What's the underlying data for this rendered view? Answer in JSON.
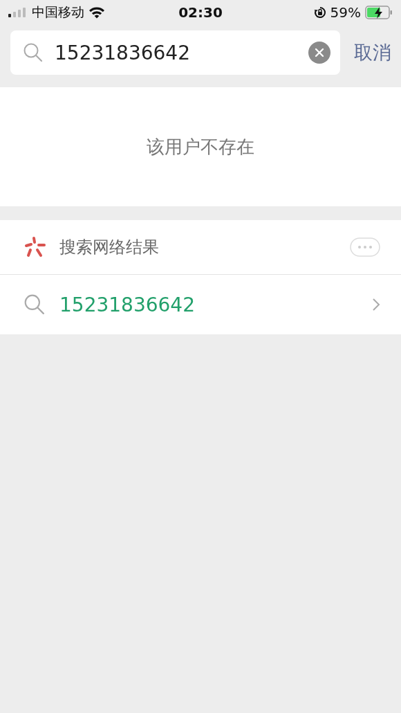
{
  "status_bar": {
    "carrier": "中国移动",
    "time": "02:30",
    "battery_percent": "59%"
  },
  "search": {
    "value": "15231836642",
    "cancel": "取消"
  },
  "empty_result": {
    "message": "该用户不存在"
  },
  "web_search": {
    "title": "搜索网络结果",
    "query": "15231836642"
  }
}
